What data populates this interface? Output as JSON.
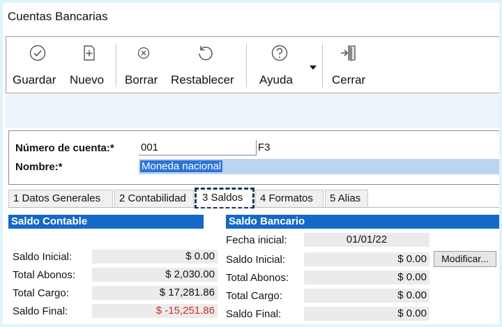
{
  "window": {
    "title": "Cuentas Bancarias"
  },
  "toolbar": {
    "guardar": "Guardar",
    "nuevo": "Nuevo",
    "borrar": "Borrar",
    "restablecer": "Restablecer",
    "ayuda": "Ayuda",
    "cerrar": "Cerrar"
  },
  "account": {
    "numero_label": "Número de cuenta:*",
    "numero_value": "001",
    "numero_key": "F3",
    "nombre_label": "Nombre:*",
    "nombre_value": "Moneda nacional"
  },
  "tabs": [
    {
      "label": "1 Datos Generales"
    },
    {
      "label": "2 Contabilidad"
    },
    {
      "label": "3 Saldos",
      "active": true
    },
    {
      "label": "4 Formatos"
    },
    {
      "label": "5 Alias"
    }
  ],
  "saldo_contable": {
    "header": "Saldo Contable",
    "rows": [
      {
        "label": "Saldo Inicial:",
        "value": "$ 0.00"
      },
      {
        "label": "Total Abonos:",
        "value": "$ 2,030.00"
      },
      {
        "label": "Total Cargo:",
        "value": "$ 17,281.86"
      },
      {
        "label": "Saldo Final:",
        "value": "$ -15,251.86"
      }
    ]
  },
  "saldo_bancario": {
    "header": "Saldo Bancario",
    "fecha_label": "Fecha inicial:",
    "fecha_value": "01/01/22",
    "rows": [
      {
        "label": "Saldo Inicial:",
        "value": "$ 0.00"
      },
      {
        "label": "Total Abonos:",
        "value": "$ 0.00"
      },
      {
        "label": "Total Cargo:",
        "value": "$ 0.00"
      },
      {
        "label": "Saldo Final:",
        "value": "$ 0.00"
      }
    ],
    "modificar": "Modificar..."
  },
  "colors": {
    "section_header": "#1469c7",
    "negative": "#d22a2a",
    "selection": "#bcd4f0",
    "active_tab_outline": "#17355e"
  }
}
